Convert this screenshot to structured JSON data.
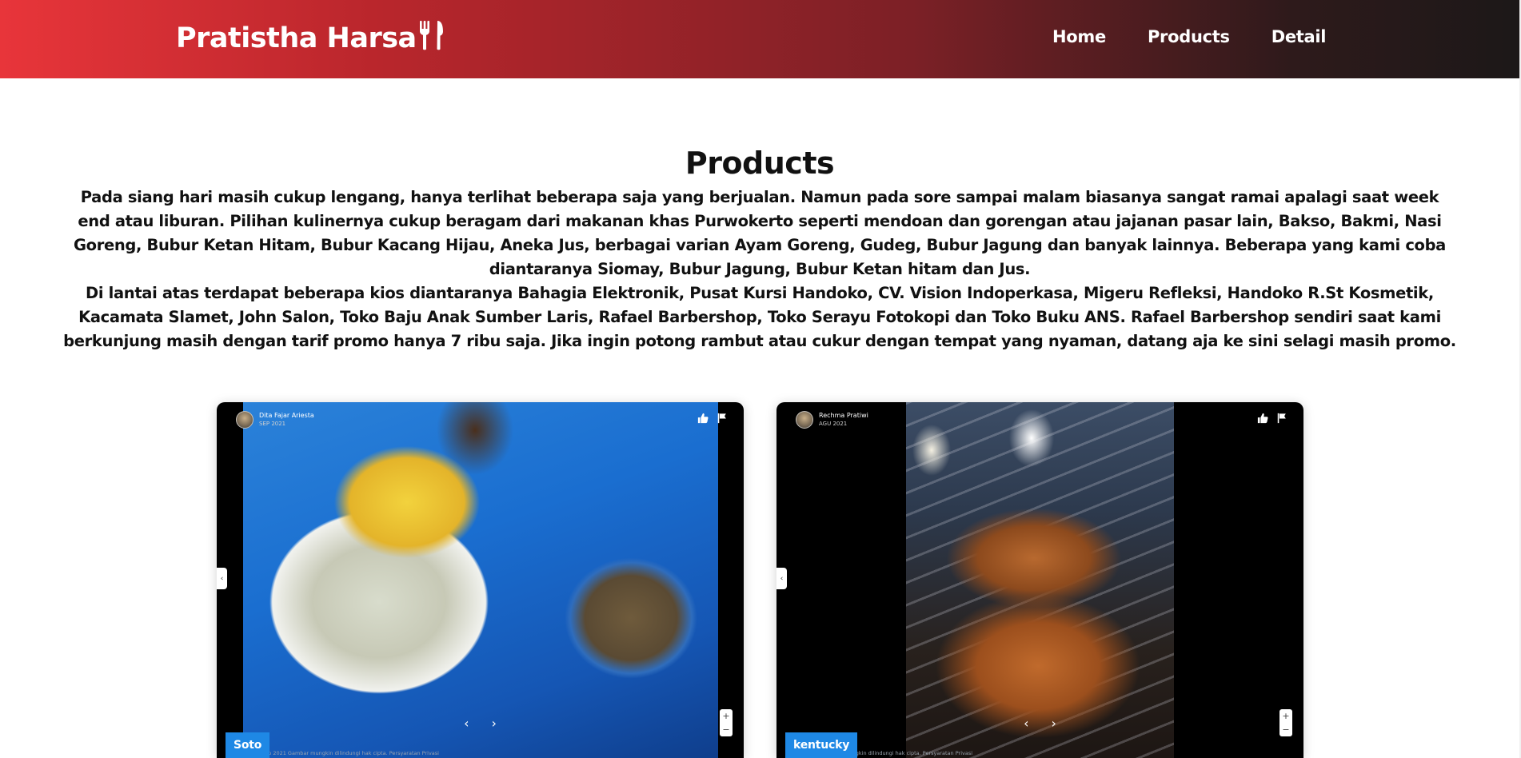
{
  "header": {
    "brand": "Pratistha Harsa",
    "nav": [
      "Home",
      "Products",
      "Detail"
    ]
  },
  "main": {
    "title": "Products",
    "paragraph1": "Pada siang hari masih cukup lengang, hanya terlihat beberapa saja yang berjualan. Namun pada sore sampai malam biasanya sangat ramai apalagi saat week end atau liburan. Pilihan kulinernya cukup beragam dari makanan khas Purwokerto seperti mendoan dan gorengan atau jajanan pasar lain, Bakso, Bakmi, Nasi Goreng, Bubur Ketan Hitam, Bubur Kacang Hijau, Aneka Jus, berbagai varian Ayam Goreng, Gudeg, Bubur Jagung dan banyak lainnya. Beberapa yang kami coba diantaranya Siomay, Bubur Jagung, Bubur Ketan hitam dan Jus.",
    "paragraph2": "Di lantai atas terdapat beberapa kios diantaranya Bahagia Elektronik, Pusat Kursi Handoko, CV. Vision Indoperkasa, Migeru Refleksi, Handoko R.St Kosmetik, Kacamata Slamet, John Salon, Toko Baju Anak Sumber Laris, Rafael Barbershop, Toko Serayu Fotokopi dan Toko Buku ANS. Rafael Barbershop sendiri saat kami berkunjung masih dengan tarif promo hanya 7 ribu saja. Jika ingin potong rambut atau cukur dengan tempat yang nyaman, datang aja ke sini selagi masih promo."
  },
  "cards": [
    {
      "poster_name": "Dita Fajar Ariesta",
      "poster_date": "SEP 2021",
      "tag": "Soto",
      "credit": "Sep 2021    Gambar mungkin dilindungi hak cipta.    Persyaratan    Privasi"
    },
    {
      "poster_name": "Rechma Pratiwi",
      "poster_date": "AGU 2021",
      "tag": "kentucky",
      "credit": "Gambar mungkin dilindungi hak cipta.    Persyaratan    Privasi"
    }
  ],
  "icons": {
    "brand": "cutlery-icon",
    "like": "thumbs-up-icon",
    "report": "flag-icon",
    "prev": "chevron-left-icon",
    "next": "chevron-right-icon",
    "collapse": "chevron-left-icon"
  },
  "controls": {
    "prev": "‹",
    "next": "›",
    "zoom_in": "+",
    "zoom_out": "−",
    "side_tab": "‹"
  },
  "colors": {
    "header_start": "#e8353a",
    "header_end": "#1c1818",
    "tag_bg": "#1e88e5"
  }
}
